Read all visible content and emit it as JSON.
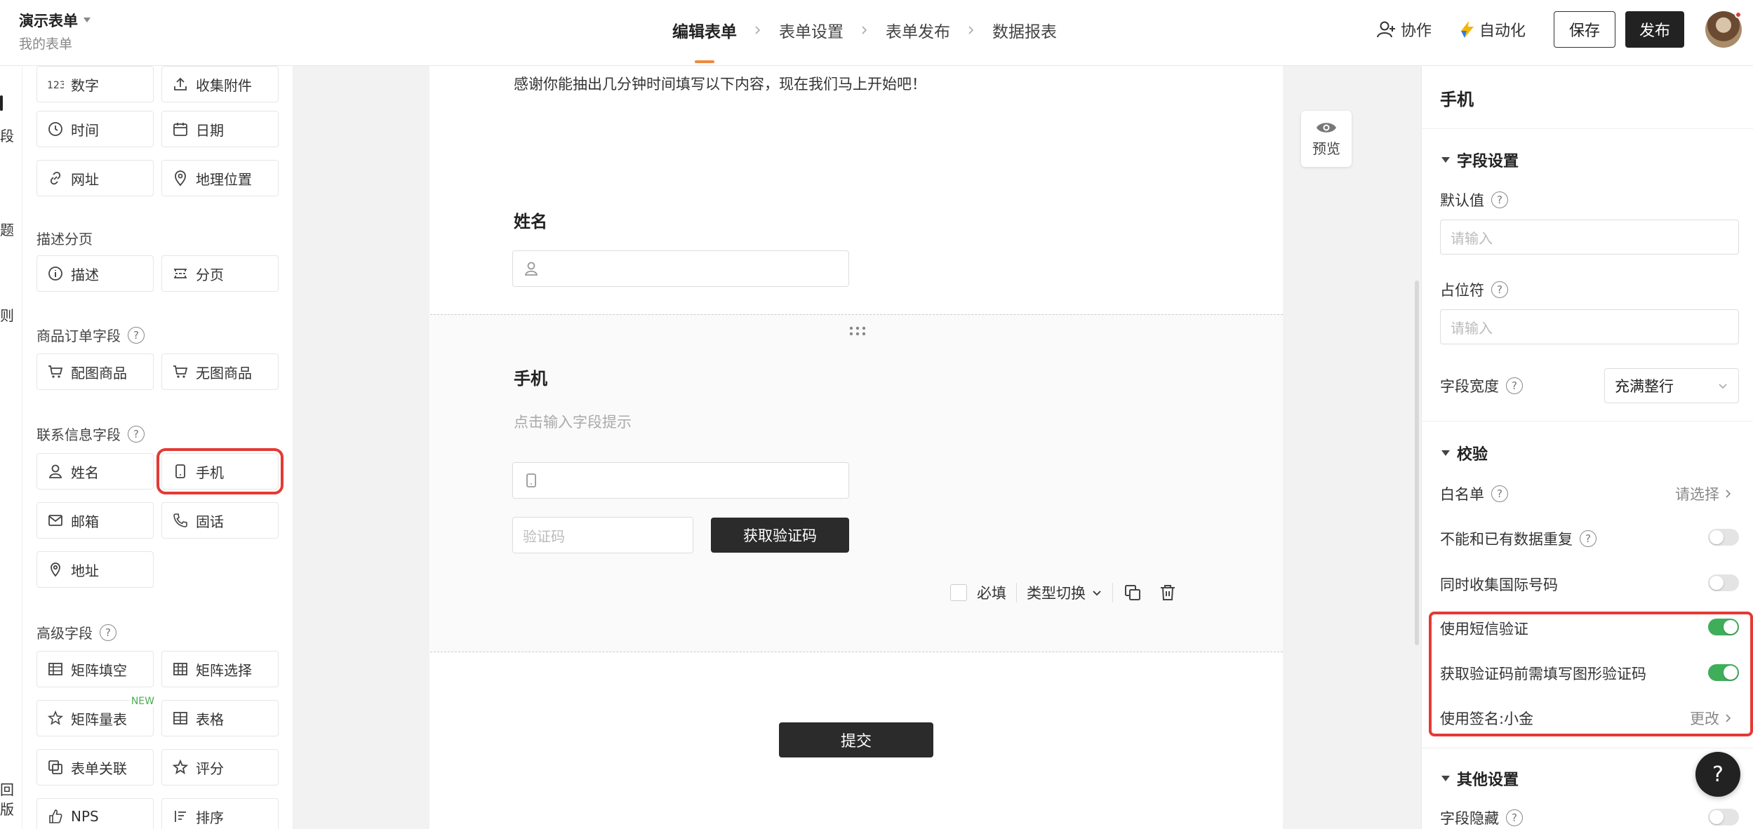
{
  "header": {
    "app_title": "演示表单",
    "app_subtitle": "我的表单",
    "steps": [
      "编辑表单",
      "表单设置",
      "表单发布",
      "数据报表"
    ],
    "collaborate": "协作",
    "automation": "自动化",
    "save": "保存",
    "publish": "发布"
  },
  "rail": {
    "items": [
      "段",
      "题",
      "则",
      "回",
      "版"
    ]
  },
  "palette": {
    "item_number": "数字",
    "item_attachment": "收集附件",
    "item_time": "时间",
    "item_date": "日期",
    "item_url": "网址",
    "item_location": "地理位置",
    "sec_desc": "描述分页",
    "item_desc": "描述",
    "item_page": "分页",
    "sec_product": "商品订单字段",
    "item_product_img": "配图商品",
    "item_product_noimg": "无图商品",
    "sec_contact": "联系信息字段",
    "item_name": "姓名",
    "item_phone": "手机",
    "item_email": "邮箱",
    "item_tel": "固话",
    "item_address": "地址",
    "sec_advanced": "高级字段",
    "item_matrix_fill": "矩阵填空",
    "item_matrix_select": "矩阵选择",
    "item_matrix_scale": "矩阵量表",
    "new_tag": "NEW",
    "item_table": "表格",
    "item_form_link": "表单关联",
    "item_rating": "评分",
    "item_nps": "NPS",
    "item_sort": "排序"
  },
  "form": {
    "intro": "感谢你能抽出几分钟时间填写以下内容，现在我们马上开始吧！",
    "name_title": "姓名",
    "phone_title": "手机",
    "phone_hint": "点击输入字段提示",
    "code_placeholder": "验证码",
    "get_code": "获取验证码",
    "required": "必填",
    "type_switch": "类型切换",
    "submit": "提交",
    "preview": "预览"
  },
  "settings": {
    "title": "手机",
    "sec_field": "字段设置",
    "default_value": "默认值",
    "default_placeholder": "请输入",
    "placeholder_label": "占位符",
    "placeholder_placeholder": "请输入",
    "width_label": "字段宽度",
    "width_value": "充满整行",
    "sec_validation": "校验",
    "whitelist": "白名单",
    "whitelist_value": "请选择",
    "no_dup": "不能和已有数据重复",
    "intl_code": "同时收集国际号码",
    "sms_verify": "使用短信验证",
    "captcha": "获取验证码前需填写图形验证码",
    "signature": "使用签名:小金",
    "signature_action": "更改",
    "sec_other": "其他设置",
    "hide_field": "字段隐藏",
    "toggles": {
      "no_dup": false,
      "intl_code": false,
      "sms_verify": true,
      "captcha": true,
      "hide_field": false
    }
  },
  "help_fab": "?",
  "colors": {
    "accent": "#f08a3c",
    "toggle_on": "#3fae5a",
    "highlight": "#e53935",
    "dark_button": "#2b2b2b"
  }
}
